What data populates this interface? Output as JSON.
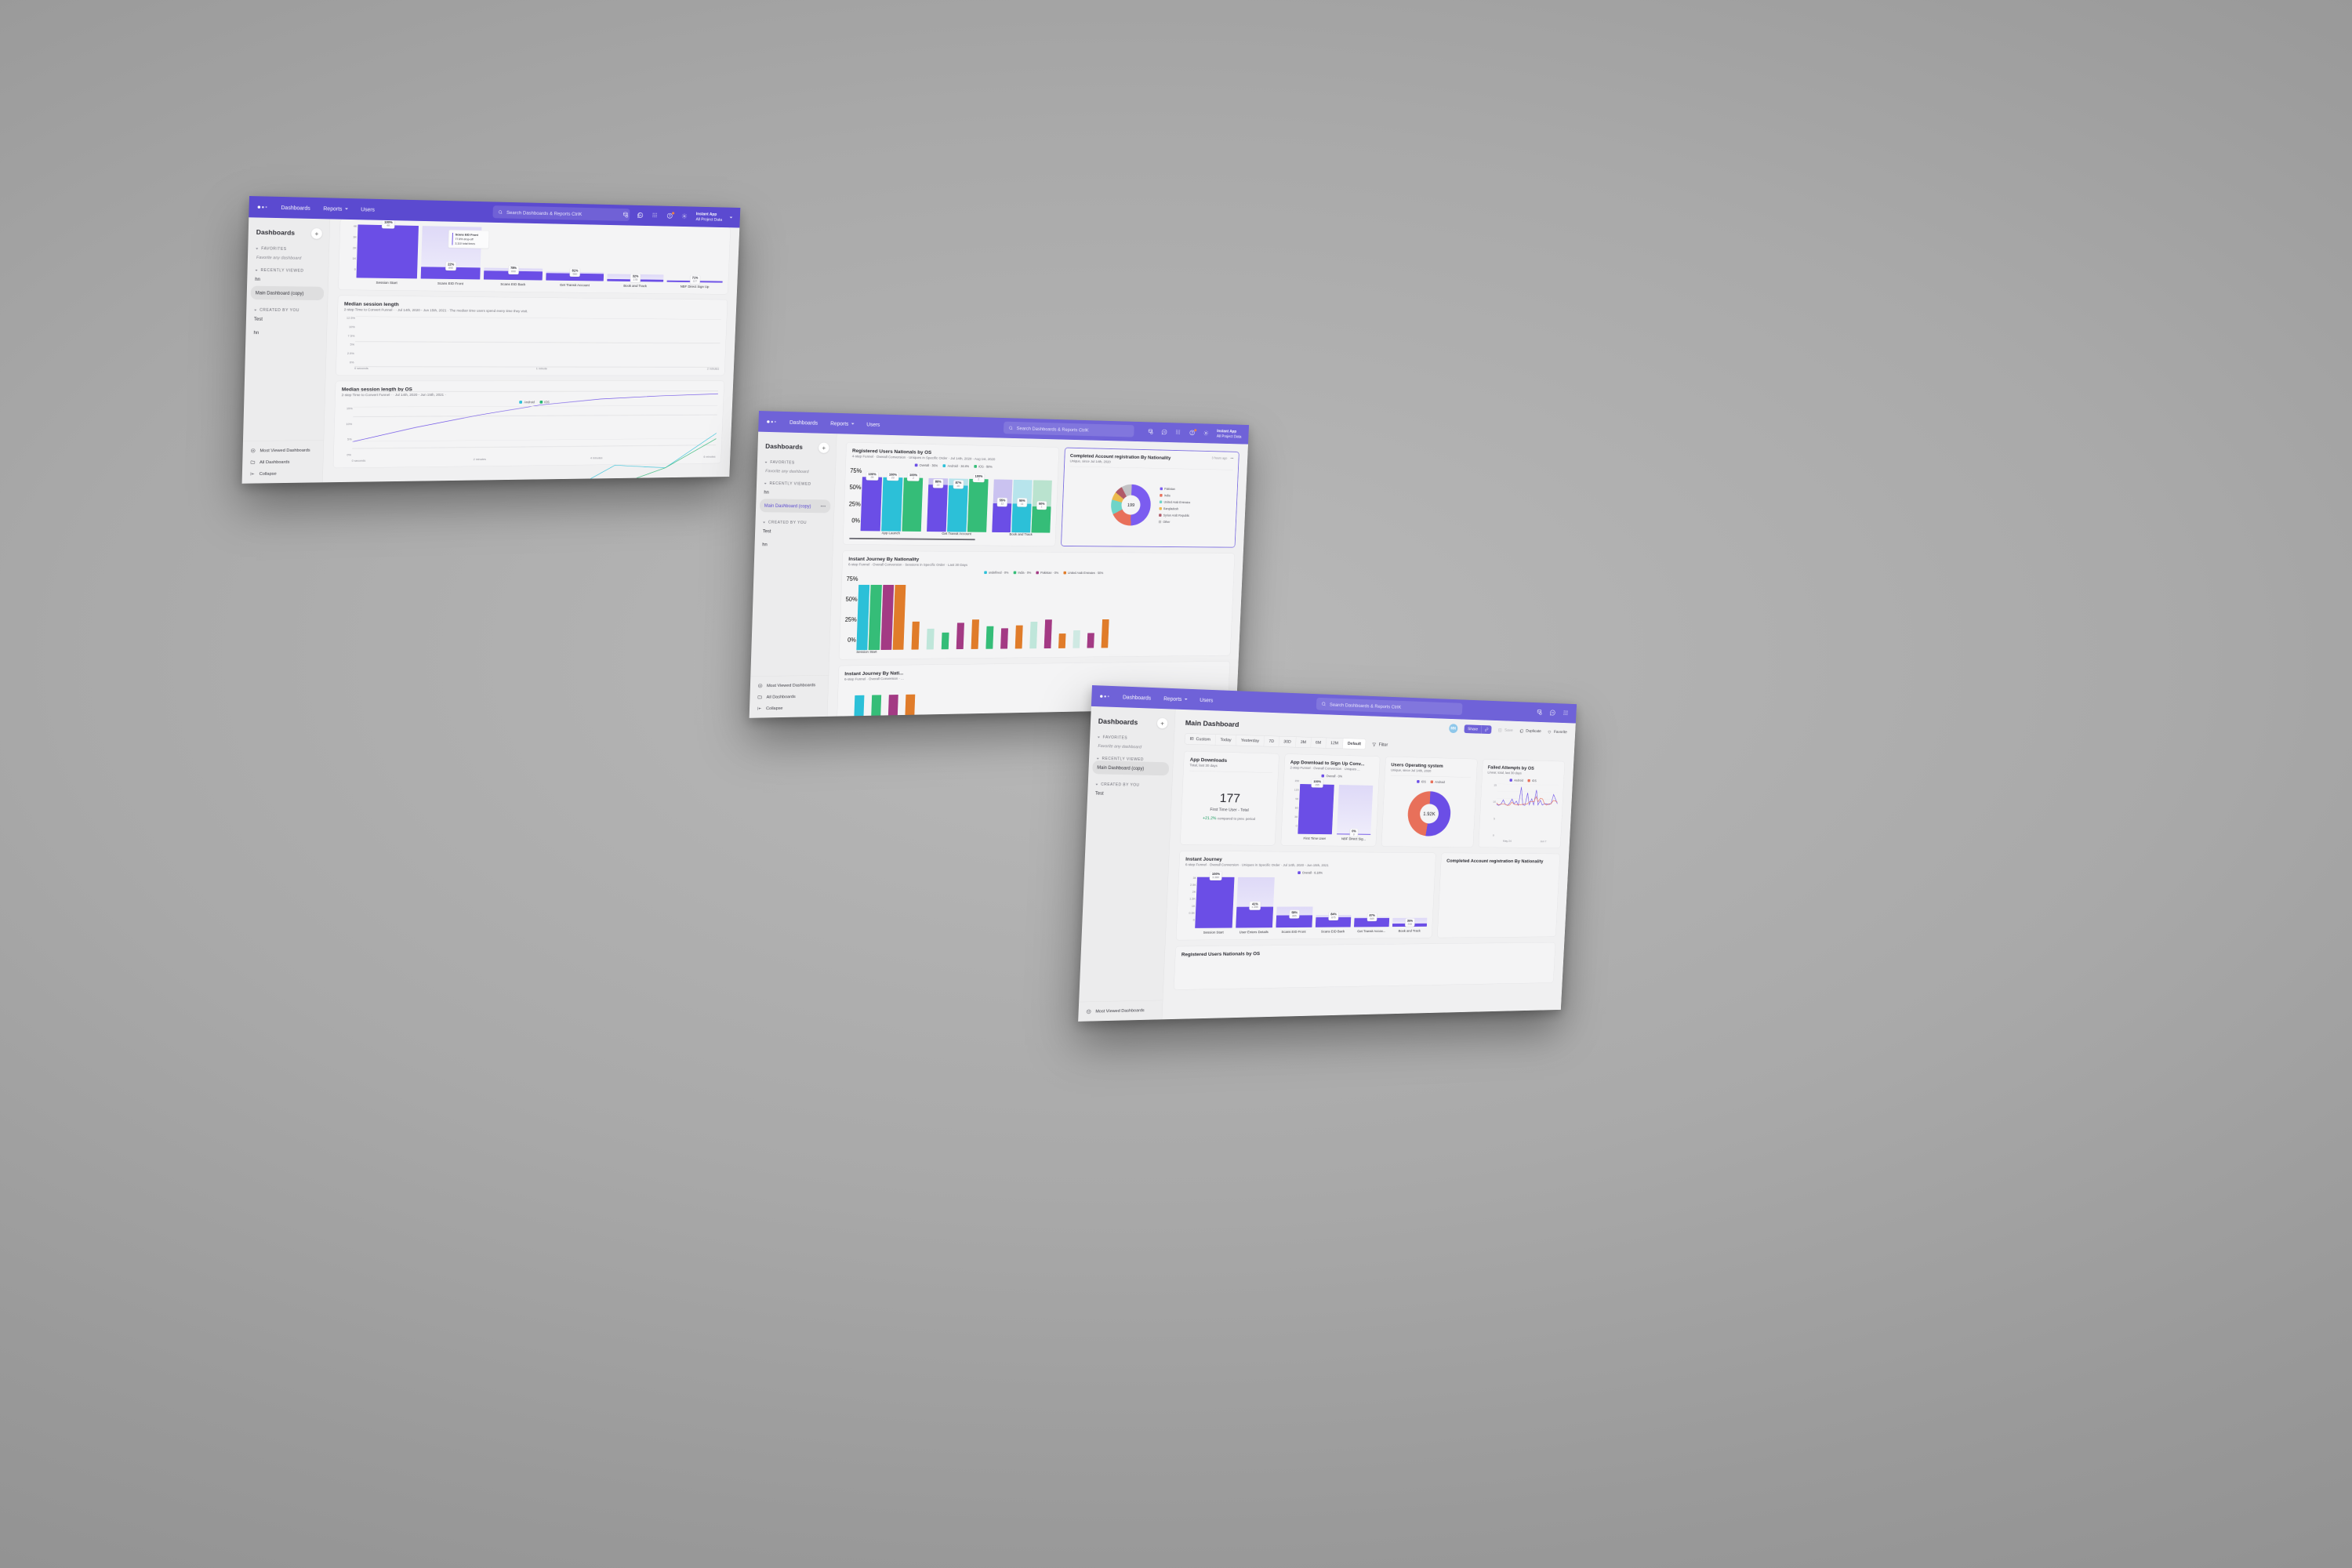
{
  "brand": {
    "purple": "#5b4ad0",
    "purple_light": "#6f62d8",
    "bar_purple": "#6b4ee6",
    "ios_red": "#e8705a",
    "android_teal": "#2cc0d8",
    "green": "#35bd78"
  },
  "topbar": {
    "nav": [
      {
        "label": "Dashboards",
        "caret": false
      },
      {
        "label": "Reports",
        "caret": true
      },
      {
        "label": "Users",
        "caret": false
      }
    ],
    "search_placeholder": "Search Dashboards & Reports CtrlK",
    "icons": [
      "database-icon",
      "chat-bubble-icon",
      "apps-grid-icon",
      "help-circle-icon",
      "gear-icon"
    ],
    "project": {
      "name": "Instant App",
      "scope": "All Project Data"
    }
  },
  "sidebar": {
    "title": "Dashboards",
    "add_button": "+",
    "groups": [
      {
        "label": "FAVORITES",
        "empty_text": "Favorite any dashboard",
        "items": []
      },
      {
        "label": "RECENTLY VIEWED",
        "items": [
          "hn",
          "Main Dashboard (copy)"
        ],
        "active": "Main Dashboard (copy)"
      },
      {
        "label": "CREATED BY YOU",
        "items": [
          "Test",
          "hn"
        ]
      }
    ],
    "footer": [
      {
        "label": "Most Viewed Dashboards",
        "icon": "smiley-icon"
      },
      {
        "label": "All Dashboards",
        "icon": "folder-icon"
      },
      {
        "label": "Collapse",
        "icon": "collapse-icon"
      }
    ]
  },
  "front": {
    "page_title": "Main Dashboard",
    "date_tabs": [
      "Custom",
      "Today",
      "Yesterday",
      "7D",
      "30D",
      "3M",
      "6M",
      "12M",
      "Default"
    ],
    "date_selected": "Default",
    "filter_label": "Filter",
    "toolbar": {
      "avatar": "MN",
      "share": "Share",
      "save": "Save",
      "duplicate": "Duplicate",
      "favorite": "Favorite"
    },
    "cards": {
      "app_downloads": {
        "title": "App Downloads",
        "subtitle": "Total, last 30 days",
        "value": "177",
        "metric": "First Time User - Total",
        "delta": "+21.2%",
        "delta_note": "compared to prev. period"
      },
      "signup_conv": {
        "title": "App Download to Sign Up Conv...",
        "subtitle": "2-step Funnel · Overall Conversion · Uniques ...",
        "legend": "Overall · 0%"
      },
      "users_os": {
        "title": "Users Operating system",
        "subtitle": "Unique, since Jul 14th, 2020",
        "center": "1.92K"
      },
      "failed_attempts": {
        "title": "Failed Attempts by OS",
        "subtitle": "Linear, total, last 30 days"
      },
      "instant_journey": {
        "title": "Instant Journey",
        "subtitle": "6-step Funnel · Overall Conversion · Uniques in Specific Order · Jul 14th, 2020 - Jun 15th, 2021",
        "legend": "Overall · 6.18%"
      },
      "registered_users": {
        "title": "Registered Users Nationals by OS"
      },
      "completed_account": {
        "title": "Completed Account registration By Nationality"
      }
    }
  },
  "mid": {
    "cards": {
      "registered_users": {
        "title": "Registered Users Nationals by OS",
        "subtitle": "4-step Funnel · Overall Conversion · Uniques in Specific Order · Jul 14th, 2020 - Aug 1st, 2020"
      },
      "completed_account": {
        "title": "Completed Account registration By Nationality",
        "subtitle": "Unique, since Jul 14th, 2020",
        "meta_time": "3 hours ago",
        "menu": "•••",
        "center": "199"
      },
      "instant_journey_nat": {
        "title": "Instant Journey By Nationality",
        "subtitle": "6-step Funnel · Overall Conversion · Sessions in Specific Order · Last 30 Days"
      },
      "instant_journey_nat2": {
        "title": "Instant Journey By Nati...",
        "subtitle": "6-step Funnel · Overall Conversion · ..."
      }
    }
  },
  "back": {
    "cards": {
      "funnel": {
        "tooltip": {
          "step": "Scans EID Front",
          "dropoff": "77.8% drop-off",
          "total": "3,110 total times"
        }
      },
      "median_session": {
        "title": "Median session length",
        "subtitle": "2-step Time to Convert Funnel · · Jul 14th, 2020 - Jun 15th, 2021 · The median time users spend every time they visit."
      },
      "median_session_os": {
        "title": "Median session length by OS",
        "subtitle": "2-step Time to Convert Funnel · · Jul 14th, 2020 - Jun 15th, 2021 ·"
      }
    }
  },
  "chart_data": [
    {
      "id": "back-funnel",
      "type": "bar",
      "title": "Instant Journey funnel",
      "ylabel": "",
      "yticks": [
        "0",
        "1K",
        "2K",
        "3K",
        "4K"
      ],
      "ylim": [
        0,
        4000
      ],
      "categories": [
        "Session Start",
        "Scans EID Front",
        "Scans EID Back",
        "Get Transit Account",
        "Book and Track",
        "NBF Direct Sign Up"
      ],
      "values": [
        4000,
        890,
        690,
        560,
        178,
        127
      ],
      "pct_labels": [
        "100%",
        "22%",
        "78%",
        "81%",
        "32%",
        "71%"
      ],
      "val_labels": [
        "4K",
        "890",
        "690",
        "560",
        "178",
        "127"
      ],
      "color": "#6b4ee6"
    },
    {
      "id": "back-median-session",
      "type": "line",
      "title": "Median session length",
      "ylabel": "",
      "yticks": [
        "0%",
        "2.5%",
        "5%",
        "7.5%",
        "10%",
        "12.5%"
      ],
      "ylim": [
        0,
        12.5
      ],
      "xticks": [
        "0 seconds",
        "1 minute",
        "2 minutes"
      ],
      "series": [
        {
          "name": "Overall",
          "color": "#6b4ee6",
          "values": [
            0,
            1.4,
            2.6,
            3.6,
            4.2,
            4.5,
            4.7
          ]
        }
      ]
    },
    {
      "id": "back-median-session-os",
      "type": "line",
      "title": "Median session length by OS",
      "yticks": [
        "0%",
        "5%",
        "10%",
        "15%"
      ],
      "ylim": [
        0,
        15
      ],
      "xticks": [
        "0 seconds",
        "2 minutes",
        "4 minutes",
        "6 minutes"
      ],
      "series": [
        {
          "name": "Android",
          "color": "#2cc0d8",
          "values": [
            0,
            2.6,
            5.0,
            5.0,
            4.1,
            7.6,
            7.2,
            11.5
          ]
        },
        {
          "name": "iOS",
          "color": "#2bb673",
          "values": [
            0,
            0.2,
            0.3,
            4.0,
            4.1,
            5.0,
            7.2,
            10.8
          ]
        }
      ]
    },
    {
      "id": "mid-registered-users",
      "type": "bar",
      "title": "Registered Users Nationals by OS",
      "yticks": [
        "0%",
        "25%",
        "50%",
        "75%"
      ],
      "ylim": [
        0,
        100
      ],
      "categories": [
        "App Launch",
        "Get Transit Account",
        "Book and Track"
      ],
      "series": [
        {
          "name": "Overall · 36%",
          "color": "#6b4ee6",
          "values": [
            100,
            88,
            55
          ],
          "labels": [
            "25",
            "22",
            "12"
          ]
        },
        {
          "name": "Android · 34.8%",
          "color": "#2cc0d8",
          "values": [
            100,
            87,
            55
          ],
          "labels": [
            "23",
            "20",
            "11"
          ]
        },
        {
          "name": "iOS · 50%",
          "color": "#35bd78",
          "values": [
            100,
            100,
            50
          ],
          "labels": [
            "2",
            "2",
            "1"
          ]
        }
      ]
    },
    {
      "id": "mid-completed-account",
      "type": "pie",
      "title": "Completed Account registration By Nationality",
      "center": "199",
      "labels": [
        "Pakistan",
        "India",
        "United Arab Emirates",
        "Bangladesh",
        "Syrian Arab Republic",
        "Other"
      ],
      "values": [
        47,
        17,
        11,
        6,
        6,
        8
      ],
      "colors": [
        "#7b5cf0",
        "#e8705a",
        "#6fd4c8",
        "#ecba4d",
        "#b05a68",
        "#c2c2c4"
      ]
    },
    {
      "id": "mid-instant-journey-nat",
      "type": "bar",
      "title": "Instant Journey By Nationality",
      "yticks": [
        "0%",
        "25%",
        "50%",
        "75%"
      ],
      "ylim": [
        0,
        100
      ],
      "categories": [
        "Session Start"
      ],
      "legend": [
        "undefined · 0%",
        "India · 0%",
        "Pakistan · 0%",
        "United Arab Emirates · 50%"
      ],
      "legend_colors": [
        "#2cc0d8",
        "#35bd78",
        "#a33a84",
        "#e07c2a"
      ]
    },
    {
      "id": "front-signup-funnel",
      "type": "bar",
      "title": "App Download to Sign Up Conv...",
      "yticks": [
        "0",
        "30",
        "60",
        "90",
        "120",
        "150"
      ],
      "ylim": [
        0,
        170
      ],
      "categories": [
        "First Time User",
        "NBF Direct Sig..."
      ],
      "values": [
        155,
        0
      ],
      "pct_labels": [
        "100%",
        "0%"
      ],
      "val_labels": [
        "155",
        "0"
      ],
      "color": "#6b4ee6",
      "legend": "Overall · 0%"
    },
    {
      "id": "front-users-os",
      "type": "pie",
      "title": "Users Operating system",
      "center": "1.92K",
      "labels": [
        "iOS",
        "Android"
      ],
      "values": [
        52,
        48
      ],
      "colors": [
        "#6b4ee6",
        "#e8705a"
      ]
    },
    {
      "id": "front-failed-attempts",
      "type": "line",
      "title": "Failed Attempts by OS",
      "yticks": [
        "0",
        "5",
        "10",
        "15"
      ],
      "ylim": [
        0,
        16
      ],
      "xticks": [
        "May 24",
        "Jun 7"
      ],
      "series": [
        {
          "name": "Android",
          "color": "#6b4ee6",
          "values": [
            1,
            0.2,
            1,
            4.3,
            1,
            0.3,
            2,
            5,
            1.5,
            3.5,
            0.5,
            14,
            1,
            0.5,
            9.7,
            1,
            5.5,
            1,
            12,
            1,
            4.5,
            1,
            2,
            2,
            1.5,
            2,
            9,
            5.5,
            2
          ]
        },
        {
          "name": "iOS",
          "color": "#e8705a",
          "values": [
            2,
            0.5,
            1.2,
            1.2,
            1.2,
            0.3,
            0.5,
            2.8,
            1.2,
            1,
            1,
            1,
            1.3,
            1.5,
            1.5,
            3.3,
            3.3,
            3.3,
            7,
            3.5,
            6,
            5.5,
            2,
            1,
            2,
            2,
            4.5,
            4.2,
            3.2
          ]
        }
      ]
    },
    {
      "id": "front-instant-journey",
      "type": "bar",
      "title": "Instant Journey",
      "yticks": [
        "0",
        "0.5K",
        "1K",
        "1.5K",
        "2K",
        "2.5K",
        "3K"
      ],
      "ylim": [
        0,
        3400
      ],
      "categories": [
        "Session Start",
        "User Enters Details",
        "Scans EID Front",
        "Scans EID Back",
        "Get Transit Accou...",
        "Book and Track"
      ],
      "values": [
        3360,
        1390,
        805,
        675,
        589,
        208
      ],
      "pct_labels": [
        "100%",
        "41%",
        "58%",
        "84%",
        "87%",
        "35%"
      ],
      "val_labels": [
        "3.36K",
        "1.39K",
        "805",
        "675",
        "589",
        "208"
      ],
      "color": "#6b4ee6",
      "legend": "Overall · 6.18%"
    },
    {
      "id": "front-app-downloads",
      "type": "table",
      "title": "App Downloads",
      "value": "177",
      "metric": "First Time User - Total",
      "delta": "+21.2%"
    }
  ]
}
